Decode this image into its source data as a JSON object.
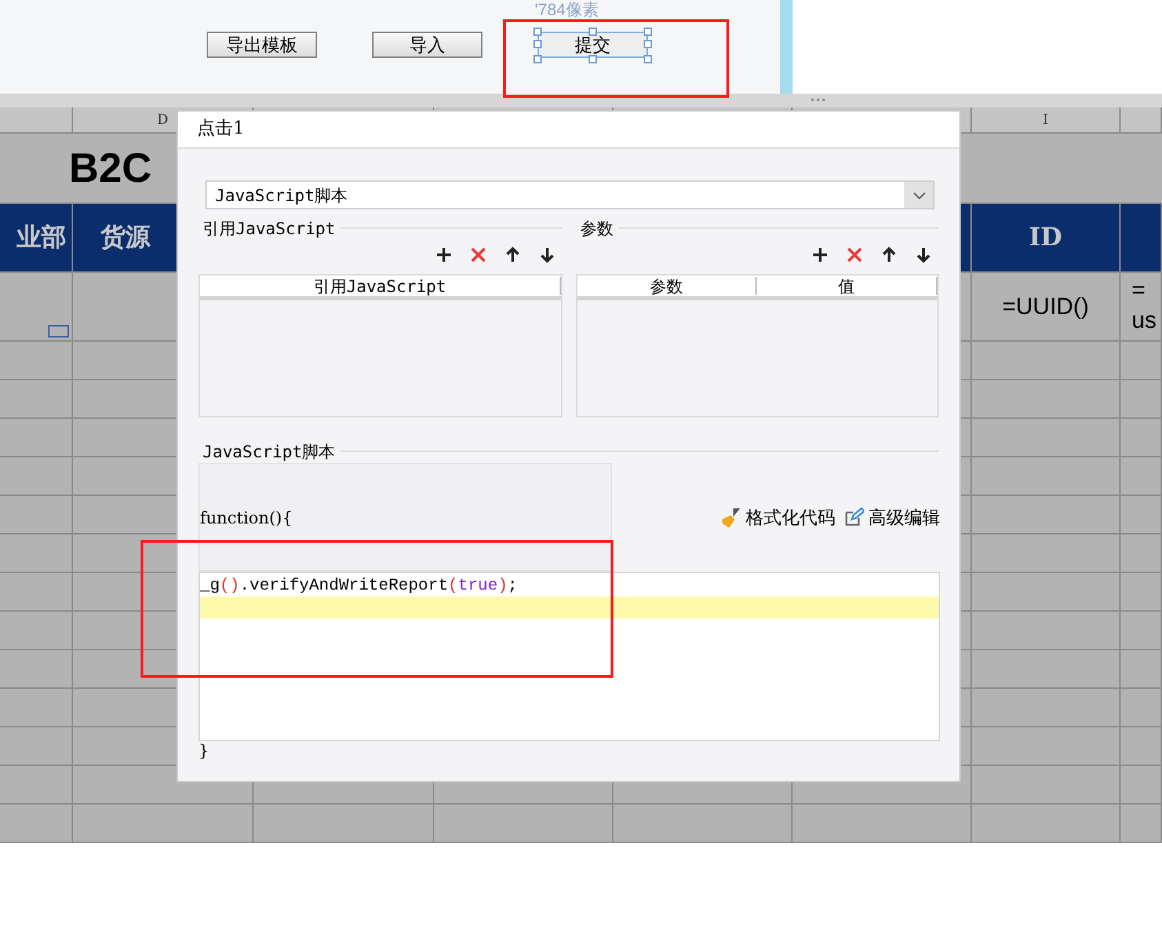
{
  "top_panel": {
    "size_note": "'784像素",
    "buttons": [
      {
        "label": "导出模板",
        "selected": false
      },
      {
        "label": "导入",
        "selected": false
      },
      {
        "label": "提交",
        "selected": true
      }
    ]
  },
  "sheet": {
    "column_headers": [
      "D",
      "I"
    ],
    "title": "B2C",
    "header_cells": [
      "业部",
      "货源",
      "ID"
    ],
    "data_cells": [
      {
        "lines": [
          "=UUID()"
        ]
      },
      {
        "lines": [
          "=",
          "us"
        ]
      }
    ]
  },
  "dialog": {
    "title": "点击1",
    "type_select": {
      "value": "JavaScript脚本"
    },
    "imports": {
      "title": "引用JavaScript",
      "columns": [
        "引用JavaScript"
      ]
    },
    "params": {
      "title": "参数",
      "columns": [
        "参数",
        "值"
      ]
    },
    "script": {
      "title": "JavaScript脚本",
      "header": "function(){",
      "actions": [
        "格式化代码",
        "高级编辑"
      ],
      "lines": [
        {
          "current": false,
          "tokens": [
            {
              "text": "_g",
              "kind": "plain"
            },
            {
              "text": "()",
              "kind": "paren"
            },
            {
              "text": ".verifyAndWriteReport",
              "kind": "plain"
            },
            {
              "text": "(",
              "kind": "paren"
            },
            {
              "text": "true",
              "kind": "keyword"
            },
            {
              "text": ")",
              "kind": "paren"
            },
            {
              "text": ";",
              "kind": "plain"
            }
          ]
        },
        {
          "current": true
        }
      ],
      "footer": "}"
    }
  }
}
